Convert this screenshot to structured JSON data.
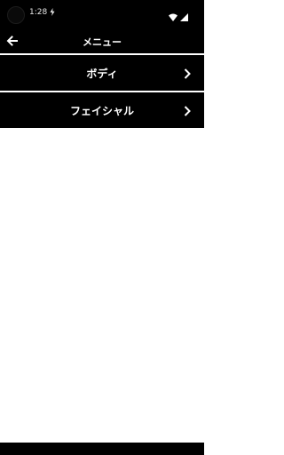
{
  "status_bar": {
    "time": "1:28",
    "battery_icon": "battery-icon",
    "wifi_icon": "wifi-icon",
    "signal_icon": "signal-icon"
  },
  "app_bar": {
    "title": "メニュー",
    "back_icon": "back-arrow-icon"
  },
  "menu": {
    "items": [
      {
        "label": "ボディ",
        "icon": "chevron-right-icon"
      },
      {
        "label": "フェイシャル",
        "icon": "chevron-right-icon"
      }
    ]
  },
  "colors": {
    "bar_background": "#000000",
    "text": "#ffffff",
    "content_background": "#ffffff"
  }
}
